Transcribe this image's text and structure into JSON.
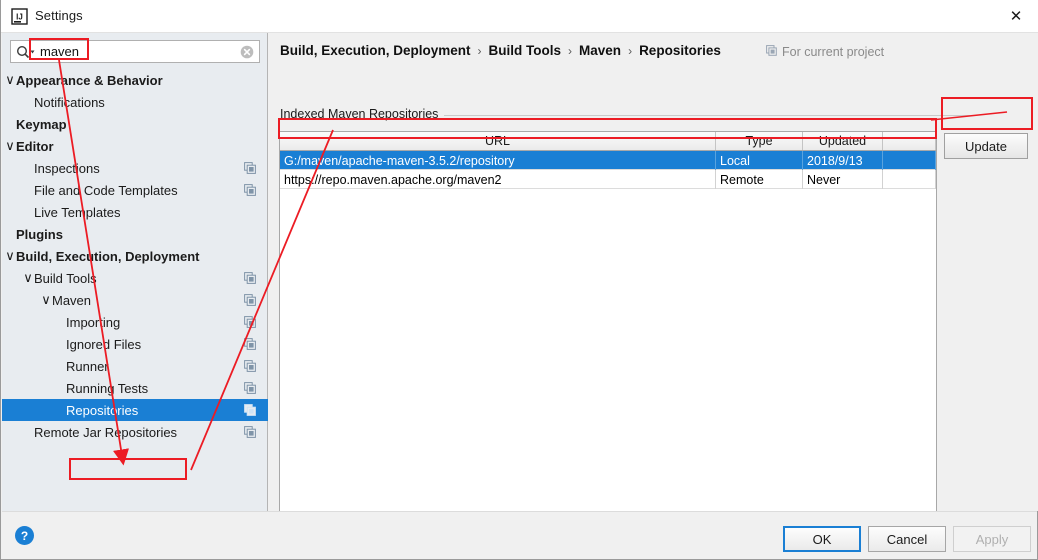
{
  "window": {
    "title": "Settings",
    "app_icon": "intellij-idea-icon",
    "close_label": "✕"
  },
  "search": {
    "value": "maven",
    "placeholder": "",
    "search_icon": "search-icon",
    "clear_icon": "clear-icon"
  },
  "sidebar": {
    "items": [
      {
        "label": "Appearance & Behavior",
        "indent": 0,
        "bold": true,
        "chevron": "∨",
        "copy": false,
        "selected": false
      },
      {
        "label": "Notifications",
        "indent": 1,
        "bold": false,
        "chevron": "",
        "copy": false,
        "selected": false
      },
      {
        "label": "Keymap",
        "indent": 0,
        "bold": true,
        "chevron": "",
        "copy": false,
        "selected": false
      },
      {
        "label": "Editor",
        "indent": 0,
        "bold": true,
        "chevron": "∨",
        "copy": false,
        "selected": false
      },
      {
        "label": "Inspections",
        "indent": 1,
        "bold": false,
        "chevron": "",
        "copy": true,
        "selected": false
      },
      {
        "label": "File and Code Templates",
        "indent": 1,
        "bold": false,
        "chevron": "",
        "copy": true,
        "selected": false
      },
      {
        "label": "Live Templates",
        "indent": 1,
        "bold": false,
        "chevron": "",
        "copy": false,
        "selected": false
      },
      {
        "label": "Plugins",
        "indent": 0,
        "bold": true,
        "chevron": "",
        "copy": false,
        "selected": false
      },
      {
        "label": "Build, Execution, Deployment",
        "indent": 0,
        "bold": true,
        "chevron": "∨",
        "copy": false,
        "selected": false
      },
      {
        "label": "Build Tools",
        "indent": 1,
        "bold": false,
        "chevron": "∨",
        "copy": true,
        "selected": false
      },
      {
        "label": "Maven",
        "indent": 2,
        "bold": false,
        "chevron": "∨",
        "copy": true,
        "selected": false
      },
      {
        "label": "Importing",
        "indent": 3,
        "bold": false,
        "chevron": "",
        "copy": true,
        "selected": false
      },
      {
        "label": "Ignored Files",
        "indent": 3,
        "bold": false,
        "chevron": "",
        "copy": true,
        "selected": false
      },
      {
        "label": "Runner",
        "indent": 3,
        "bold": false,
        "chevron": "",
        "copy": true,
        "selected": false
      },
      {
        "label": "Running Tests",
        "indent": 3,
        "bold": false,
        "chevron": "",
        "copy": true,
        "selected": false
      },
      {
        "label": "Repositories",
        "indent": 3,
        "bold": false,
        "chevron": "",
        "copy": true,
        "selected": true
      },
      {
        "label": "Remote Jar Repositories",
        "indent": 1,
        "bold": false,
        "chevron": "",
        "copy": true,
        "selected": false
      }
    ]
  },
  "content": {
    "breadcrumb": [
      "Build, Execution, Deployment",
      "Build Tools",
      "Maven",
      "Repositories"
    ],
    "breadcrumb_separator": "›",
    "for_current_project": "For current project",
    "for_current_project_icon": "project-scope-icon",
    "group_title": "Indexed Maven Repositories",
    "update_button": "Update",
    "table": {
      "columns": [
        "URL",
        "Type",
        "Updated",
        ""
      ],
      "rows": [
        {
          "url": "G:/maven/apache-maven-3.5.2/repository",
          "type": "Local",
          "updated": "2018/9/13",
          "extra": "",
          "selected": true
        },
        {
          "url": "https://repo.maven.apache.org/maven2",
          "type": "Remote",
          "updated": "Never",
          "extra": "",
          "selected": false
        }
      ]
    }
  },
  "footer": {
    "help_label": "?",
    "ok_label": "OK",
    "cancel_label": "Cancel",
    "apply_label": "Apply"
  },
  "annotations": {
    "color": "#ec1c24",
    "boxes": [
      "search-value-box",
      "sidebar-repositories-box",
      "table-selected-row-box",
      "update-button-box"
    ],
    "arrows": [
      "search-to-repositories",
      "table-row-to-repositories"
    ]
  }
}
